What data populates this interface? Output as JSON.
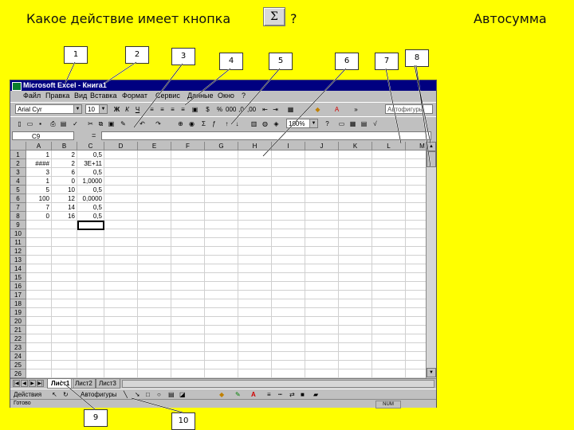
{
  "slide": {
    "question": "Какое действие имеет кнопка",
    "button_glyph": "Σ",
    "question_mark": "?",
    "answer": "Автосумма"
  },
  "callouts": [
    "1",
    "2",
    "3",
    "4",
    "5",
    "6",
    "7",
    "8",
    "9",
    "10"
  ],
  "window": {
    "title": "Microsoft Excel - Книга1",
    "menu": [
      "Файл",
      "Правка",
      "Вид",
      "Вставка",
      "Формат",
      "Сервис",
      "Данные",
      "Окно",
      "?"
    ],
    "font_name": "Arial Cyr",
    "font_size": "10",
    "zoom": "100%",
    "name_box": "C9",
    "formula_eq": "=",
    "columns": [
      "A",
      "B",
      "C",
      "D",
      "E",
      "F",
      "G",
      "H",
      "I",
      "J",
      "K",
      "L",
      "M"
    ],
    "rows": [
      "1",
      "2",
      "3",
      "4",
      "5",
      "6",
      "7",
      "8",
      "9",
      "10",
      "11",
      "12",
      "13",
      "14",
      "15",
      "16",
      "17",
      "18",
      "19",
      "20",
      "21",
      "22",
      "23",
      "24",
      "25",
      "26"
    ],
    "cells": [
      [
        "1",
        "2",
        "0,5"
      ],
      [
        "####",
        "2",
        "3E+11"
      ],
      [
        "3",
        "6",
        "0,5"
      ],
      [
        "1",
        "0",
        "1,0000"
      ],
      [
        "5",
        "10",
        "0,5"
      ],
      [
        "100",
        "12",
        "0,0000"
      ],
      [
        "7",
        "14",
        "0,5"
      ],
      [
        "0",
        "16",
        "0,5"
      ]
    ],
    "sheet_tabs": [
      "Лист1",
      "Лист2",
      "Лист3"
    ],
    "draw_actions": "Действия",
    "draw_autoshapes": "Автофигуры",
    "status_ready": "Готово",
    "status_num": "NUM"
  }
}
